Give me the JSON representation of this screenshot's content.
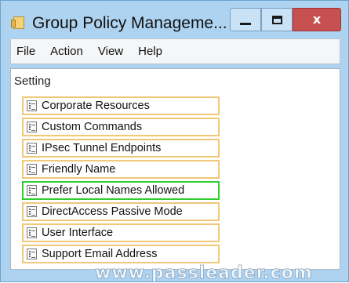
{
  "window": {
    "title": "Group Policy Manageme...",
    "buttons": {
      "minimize_icon": "minimize-icon",
      "maximize_icon": "maximize-icon",
      "close_glyph": "x"
    }
  },
  "menu": {
    "items": [
      {
        "label": "File"
      },
      {
        "label": "Action"
      },
      {
        "label": "View"
      },
      {
        "label": "Help"
      }
    ]
  },
  "list": {
    "column_header": "Setting",
    "item_icon": "setting-icon",
    "items": [
      {
        "label": "Corporate Resources",
        "selected": false
      },
      {
        "label": "Custom Commands",
        "selected": false
      },
      {
        "label": "IPsec Tunnel Endpoints",
        "selected": false
      },
      {
        "label": "Friendly Name",
        "selected": false
      },
      {
        "label": "Prefer Local Names Allowed",
        "selected": true
      },
      {
        "label": "DirectAccess Passive Mode",
        "selected": false
      },
      {
        "label": "User Interface",
        "selected": false
      },
      {
        "label": "Support Email Address",
        "selected": false
      }
    ],
    "highlight_colors": {
      "outline": "#f0c878",
      "selected_outline": "#2fcf2f"
    }
  },
  "watermark": {
    "text": "www.passleader.com"
  }
}
